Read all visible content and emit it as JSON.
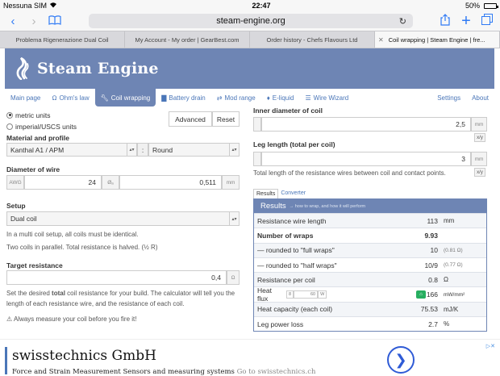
{
  "status": {
    "carrier": "Nessuna SIM",
    "time": "22:47",
    "battery": "50%"
  },
  "browser": {
    "url": "steam-engine.org",
    "tabs": [
      "Problema Rigenerazione Dual Coil",
      "My Account - My order | GearBest.com",
      "Order history - Chefs Flavours Ltd",
      "Coil wrapping | Steam Engine | fre..."
    ]
  },
  "site": {
    "title": "Steam Engine"
  },
  "nav": {
    "items": [
      "Main page",
      "Ohm's law",
      "Coil wrapping",
      "Battery drain",
      "Mod range",
      "E-liquid",
      "Wire Wizard"
    ],
    "right": [
      "Settings",
      "About"
    ]
  },
  "units": {
    "metric": "metric units",
    "imperial": "imperial/USCS units",
    "advanced": "Advanced",
    "reset": "Reset"
  },
  "material": {
    "label": "Material and profile",
    "material": "Kanthal A1 / APM",
    "profile": "Round"
  },
  "diameter": {
    "label": "Diameter of wire",
    "awg_addon": "AWG",
    "awg": "24",
    "phi_addon": "Øₐ",
    "value": "0,511",
    "unit": "mm"
  },
  "setup": {
    "label": "Setup",
    "value": "Dual coil",
    "note1": "In a multi coil setup, all coils must be identical.",
    "note2": "Two coils in parallel. Total resistance is halved. (½ R)"
  },
  "target": {
    "label": "Target resistance",
    "value": "0,4",
    "unit": "Ω",
    "note_a": "Set the desired ",
    "note_bold": "total",
    "note_b": " coil resistance for your build. The calculator will tell you the length of each resistance wire, and the resistance of each coil.",
    "warning": "Always measure your coil before you fire it!"
  },
  "inner": {
    "label": "Inner diameter of coil",
    "value": "2,5",
    "unit": "mm",
    "frac": "x/y"
  },
  "leg": {
    "label": "Leg length (total per coil)",
    "value": "3",
    "unit": "mm",
    "frac": "x/y",
    "note": "Total length of the resistance wires between coil and contact points."
  },
  "subtabs": {
    "results": "Results",
    "converter": "Converter"
  },
  "results": {
    "title": "Results",
    "hint": "→ how to wrap, and how it will perform",
    "rows": [
      {
        "key": "Resistance wire length",
        "value": "113",
        "unit": "mm"
      },
      {
        "key": "Number of wraps",
        "value": "9.93",
        "unit": ""
      },
      {
        "key": "— rounded to \"full wraps\"",
        "value": "10",
        "unit": "(0.81 Ω)"
      },
      {
        "key": "— rounded to \"half wraps\"",
        "value": "10/9",
        "unit": "(0.77 Ω)"
      },
      {
        "key": "Resistance per coil",
        "value": "0.8",
        "unit": "Ω"
      },
      {
        "key": "Heat flux",
        "value": "166",
        "unit": "mW/mm²"
      },
      {
        "key": "Heat capacity (each coil)",
        "value": "75.53",
        "unit": "mJ/K"
      },
      {
        "key": "Leg power loss",
        "value": "2.7",
        "unit": "%"
      }
    ],
    "heat_flux_input": {
      "prefix": "8",
      "watts": "60",
      "unit": "W"
    }
  },
  "ad": {
    "title": "swisstechnics GmbH",
    "desc": "Force and Strain Measurement Sensors and measuring systems",
    "link": "Go to swisstechnics.ch",
    "choices": "▷✕"
  }
}
